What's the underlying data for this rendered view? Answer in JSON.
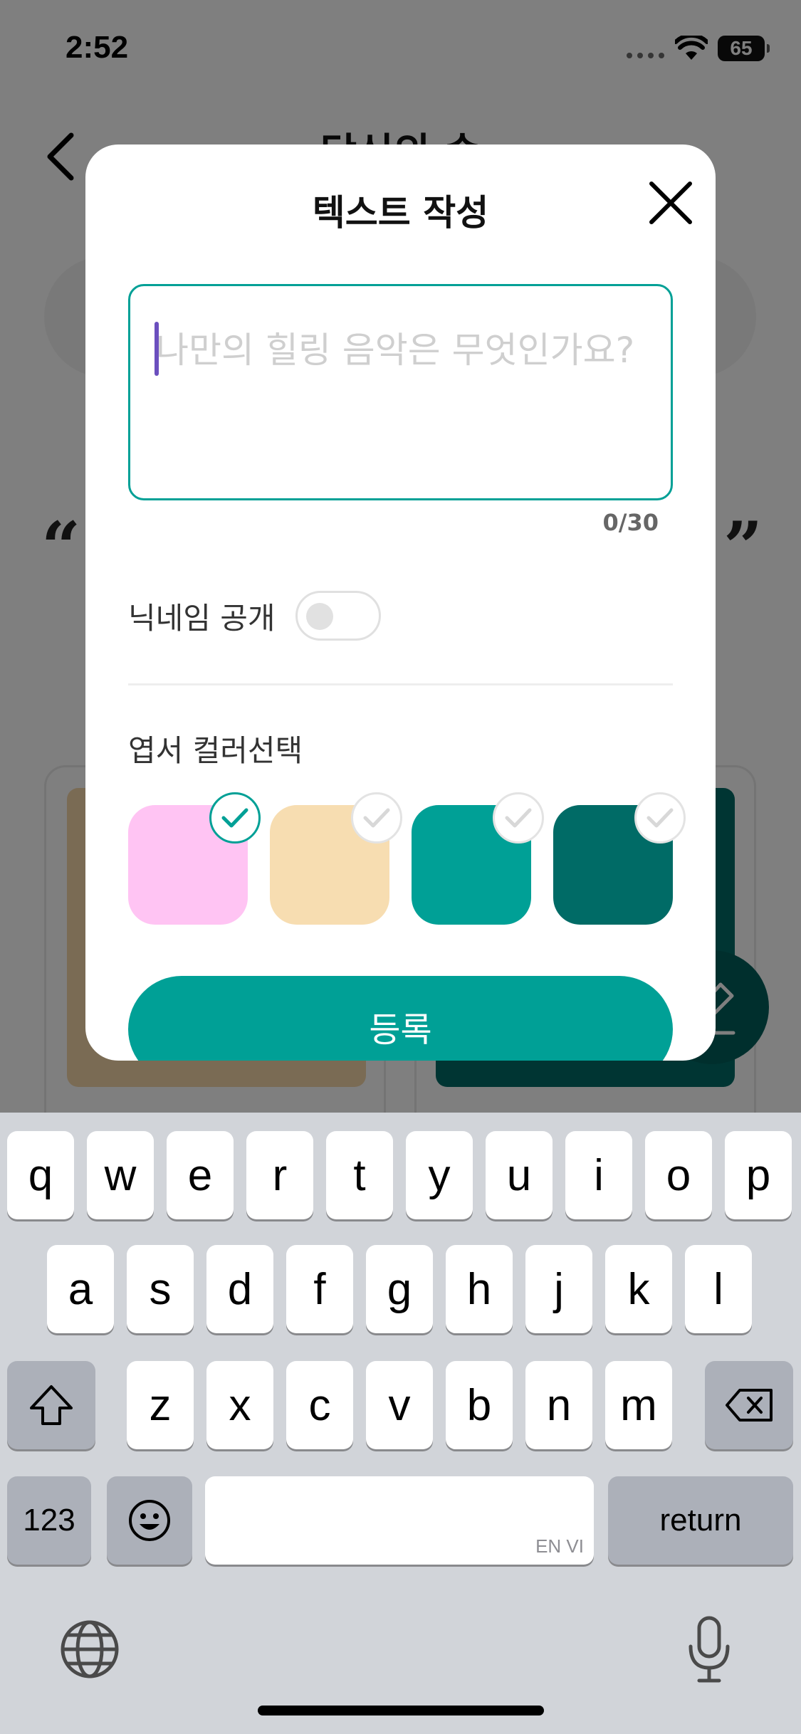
{
  "status": {
    "time": "2:52",
    "battery": "65"
  },
  "header": {
    "title": "당신의 숨"
  },
  "modal": {
    "title": "텍스트 작성",
    "placeholder": "나만의 힐링 음악은 무엇인가요?",
    "value": "",
    "counter": "0/30",
    "nickname_label": "닉네임 공개",
    "nickname_public": false,
    "color_label": "엽서 컬러선택",
    "colors": [
      {
        "hex": "#ffc4f3",
        "selected": true
      },
      {
        "hex": "#f7ddb1",
        "selected": false
      },
      {
        "hex": "#00a096",
        "selected": false
      },
      {
        "hex": "#006b66",
        "selected": false
      }
    ],
    "submit_label": "등록",
    "accent": "#00a096"
  },
  "keyboard": {
    "row1": [
      "q",
      "w",
      "e",
      "r",
      "t",
      "y",
      "u",
      "i",
      "o",
      "p"
    ],
    "row2": [
      "a",
      "s",
      "d",
      "f",
      "g",
      "h",
      "j",
      "k",
      "l"
    ],
    "row3": [
      "z",
      "x",
      "c",
      "v",
      "b",
      "n",
      "m"
    ],
    "numbers_label": "123",
    "space_hint": "EN VI",
    "return_label": "return"
  }
}
